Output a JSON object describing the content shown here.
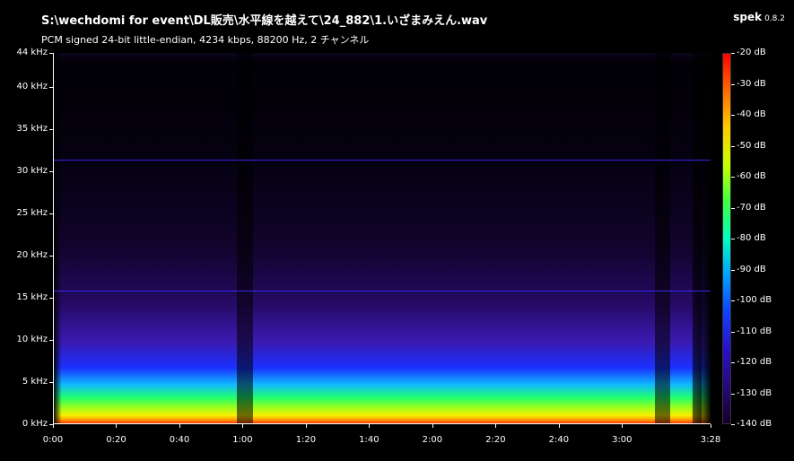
{
  "window": {
    "title": "S:\\wechdomi for event\\DL販売\\水平線を越えて\\24_882\\1.いざまみえん.wav",
    "subtitle": "PCM signed 24-bit little-endian, 4234 kbps, 88200 Hz, 2 チャンネル"
  },
  "app": {
    "name": "spek",
    "version": "0.8.2"
  },
  "axes": {
    "y_ticks": [
      "44 kHz",
      "40 kHz",
      "35 kHz",
      "30 kHz",
      "25 kHz",
      "20 kHz",
      "15 kHz",
      "10 kHz",
      "5 kHz",
      "0 kHz"
    ],
    "y_values_khz": [
      44,
      40,
      35,
      30,
      25,
      20,
      15,
      10,
      5,
      0
    ],
    "x_ticks": [
      "0:00",
      "0:20",
      "0:40",
      "1:00",
      "1:20",
      "1:40",
      "2:00",
      "2:20",
      "2:40",
      "3:00",
      "3:28"
    ],
    "x_values_sec": [
      0,
      20,
      40,
      60,
      80,
      100,
      120,
      140,
      160,
      180,
      208
    ],
    "x_max_sec": 208,
    "y_max_khz": 44
  },
  "colorbar": {
    "ticks": [
      "-20 dB",
      "-30 dB",
      "-40 dB",
      "-50 dB",
      "-60 dB",
      "-70 dB",
      "-80 dB",
      "-90 dB",
      "-100 dB",
      "-110 dB",
      "-120 dB",
      "-130 dB",
      "-140 dB"
    ],
    "db_values": [
      -20,
      -30,
      -40,
      -50,
      -60,
      -70,
      -80,
      -90,
      -100,
      -110,
      -120,
      -130,
      -140
    ],
    "db_min": -140,
    "db_max": -20
  },
  "colors": {
    "background": "#000000",
    "text": "#ffffff",
    "guide_line": "#3a2aff"
  },
  "guide_lines_khz": [
    31.4,
    15.8
  ],
  "quiet_gaps_sec": [
    [
      58,
      63
    ],
    [
      190,
      195
    ],
    [
      202,
      205
    ]
  ]
}
